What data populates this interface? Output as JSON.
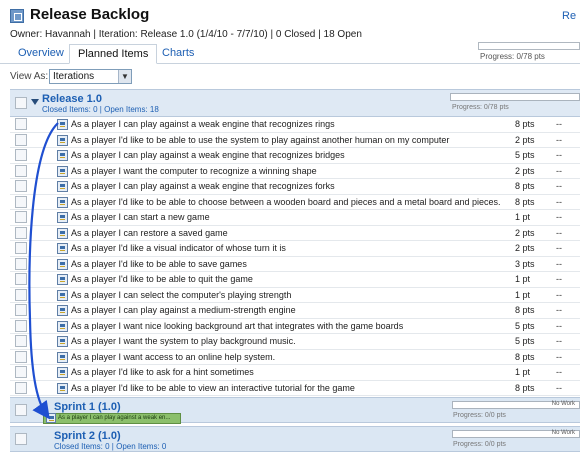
{
  "header": {
    "title": "Release Backlog",
    "corner_link": "Re",
    "meta": "Owner: Havannah  |  Iteration: Release 1.0 (1/4/10 - 7/7/10)  |  0 Closed  |  18 Open",
    "progress_label": "Progress: 0/78 pts"
  },
  "tabs": [
    {
      "label": "Overview",
      "active": false
    },
    {
      "label": "Planned Items",
      "active": true
    },
    {
      "label": "Charts",
      "active": false
    }
  ],
  "view_as": {
    "label": "View As:",
    "selected": "Iterations"
  },
  "release": {
    "name": "Release 1.0",
    "sub": "Closed Items: 0 | Open Items: 18",
    "progress_label": "Progress: 0/78 pts"
  },
  "stories": [
    {
      "text": "As a player I can play against a weak engine that recognizes rings",
      "pts": "8 pts",
      "status": "--"
    },
    {
      "text": "As a player I'd like to be able to use the system to play against another human on my computer",
      "pts": "2 pts",
      "status": "--"
    },
    {
      "text": "As a player I can play against a weak engine that recognizes bridges",
      "pts": "5 pts",
      "status": "--"
    },
    {
      "text": "As a player I want the computer to recognize a winning shape",
      "pts": "2 pts",
      "status": "--"
    },
    {
      "text": "As a player I can play against a weak engine that recognizes forks",
      "pts": "8 pts",
      "status": "--"
    },
    {
      "text": "As a player I'd like to be able to choose between a wooden board and pieces and a metal board and pieces.",
      "pts": "8 pts",
      "status": "--"
    },
    {
      "text": "As a player I can start a new game",
      "pts": "1 pt",
      "status": "--"
    },
    {
      "text": "As a player I can restore a saved game",
      "pts": "2 pts",
      "status": "--"
    },
    {
      "text": "As a player I'd like a visual indicator of whose turn it is",
      "pts": "2 pts",
      "status": "--"
    },
    {
      "text": "As a player I'd like to be able to save games",
      "pts": "3 pts",
      "status": "--"
    },
    {
      "text": "As a player I'd like to be able to quit the game",
      "pts": "1 pt",
      "status": "--"
    },
    {
      "text": "As a player I can select the computer's playing strength",
      "pts": "1 pt",
      "status": "--"
    },
    {
      "text": "As a player I can play against a medium-strength engine",
      "pts": "8 pts",
      "status": "--"
    },
    {
      "text": "As a player I want nice looking background art that integrates with the game boards",
      "pts": "5 pts",
      "status": "--"
    },
    {
      "text": "As a player I want the system to play background music.",
      "pts": "5 pts",
      "status": "--"
    },
    {
      "text": "As a player I want access to an online help system.",
      "pts": "8 pts",
      "status": "--"
    },
    {
      "text": "As a player I'd like to ask for a hint sometimes",
      "pts": "1 pt",
      "status": "--"
    },
    {
      "text": "As a player I'd like to be able to view an interactive tutorial for the game",
      "pts": "8 pts",
      "status": "--"
    }
  ],
  "sprints": [
    {
      "name": "Sprint 1 (1.0)",
      "sub": "",
      "progress_text": "No Work",
      "progress_label": "Progress: 0/0 pts"
    },
    {
      "name": "Sprint 2 (1.0)",
      "sub": "Closed Items: 0 | Open Items: 0",
      "progress_text": "No Work",
      "progress_label": "Progress: 0/0 pts"
    }
  ],
  "drag_ghost": {
    "text": "As a player I can play against a weak en..."
  },
  "colors": {
    "link": "#1d5fb3",
    "iteration_bg": "#dfe9f4",
    "drag_ghost": "#8bbf6b",
    "arrow": "#1f4fd1"
  }
}
